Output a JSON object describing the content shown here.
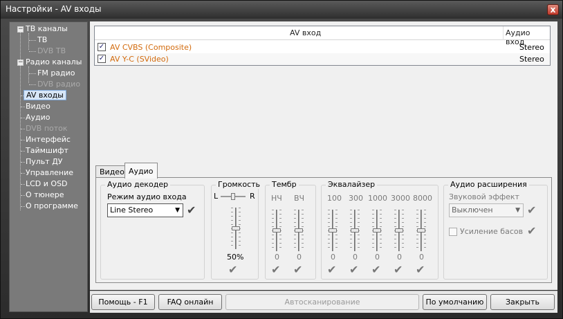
{
  "window": {
    "title": "Настройки - AV входы",
    "close_glyph": "x"
  },
  "sidebar": {
    "items": [
      {
        "label": "ТВ каналы",
        "expander": "−"
      },
      {
        "label": "ТВ"
      },
      {
        "label": "DVB ТВ"
      },
      {
        "label": "Радио каналы",
        "expander": "−"
      },
      {
        "label": "FM радио"
      },
      {
        "label": "DVB радио"
      },
      {
        "label": "AV входы"
      },
      {
        "label": "Видео"
      },
      {
        "label": "Аудио"
      },
      {
        "label": "DVB поток"
      },
      {
        "label": "Интерфейс"
      },
      {
        "label": "Таймшифт"
      },
      {
        "label": "Пульт ДУ"
      },
      {
        "label": "Управление"
      },
      {
        "label": "LCD и OSD"
      },
      {
        "label": "О тюнере"
      },
      {
        "label": "О программе"
      }
    ]
  },
  "table": {
    "headers": {
      "name": "AV вход",
      "audio": "Аудио вход"
    },
    "rows": [
      {
        "checked": "✓",
        "name": "AV CVBS (Composite)",
        "audio": "Stereo"
      },
      {
        "checked": "✓",
        "name": "AV Y-C (SVideo)",
        "audio": "Stereo"
      }
    ]
  },
  "tabs": {
    "video": "Видео",
    "audio": "Аудио"
  },
  "audio_decoder": {
    "title": "Аудио декодер",
    "mode_label": "Режим аудио входа",
    "mode_value": "Line Stereo",
    "arrow": "▼",
    "check": "✔"
  },
  "volume": {
    "title": "Громкость",
    "left": "L",
    "right": "R",
    "value": "50%",
    "level": 0.5,
    "balance": 0.5,
    "check": "✔"
  },
  "timbre": {
    "title": "Тембр",
    "bands": [
      {
        "label": "НЧ",
        "value": "0",
        "level": 0.5
      },
      {
        "label": "ВЧ",
        "value": "0",
        "level": 0.5
      }
    ],
    "check": "✔"
  },
  "equalizer": {
    "title": "Эквалайзер",
    "bands": [
      {
        "label": "100",
        "value": "0",
        "level": 0.5
      },
      {
        "label": "300",
        "value": "0",
        "level": 0.5
      },
      {
        "label": "1000",
        "value": "0",
        "level": 0.5
      },
      {
        "label": "3000",
        "value": "0",
        "level": 0.5
      },
      {
        "label": "8000",
        "value": "0",
        "level": 0.5
      }
    ],
    "check": "✔"
  },
  "audio_ext": {
    "title": "Аудио расширения",
    "effect_label": "Звуковой эффект",
    "effect_value": "Выключен",
    "arrow": "▼",
    "bass_label": "Усиление басов",
    "check": "✔"
  },
  "buttons": {
    "help": "Помощь - F1",
    "faq": "FAQ онлайн",
    "autoscan": "Автосканирование",
    "defaults": "По умолчанию",
    "close": "Закрыть"
  }
}
